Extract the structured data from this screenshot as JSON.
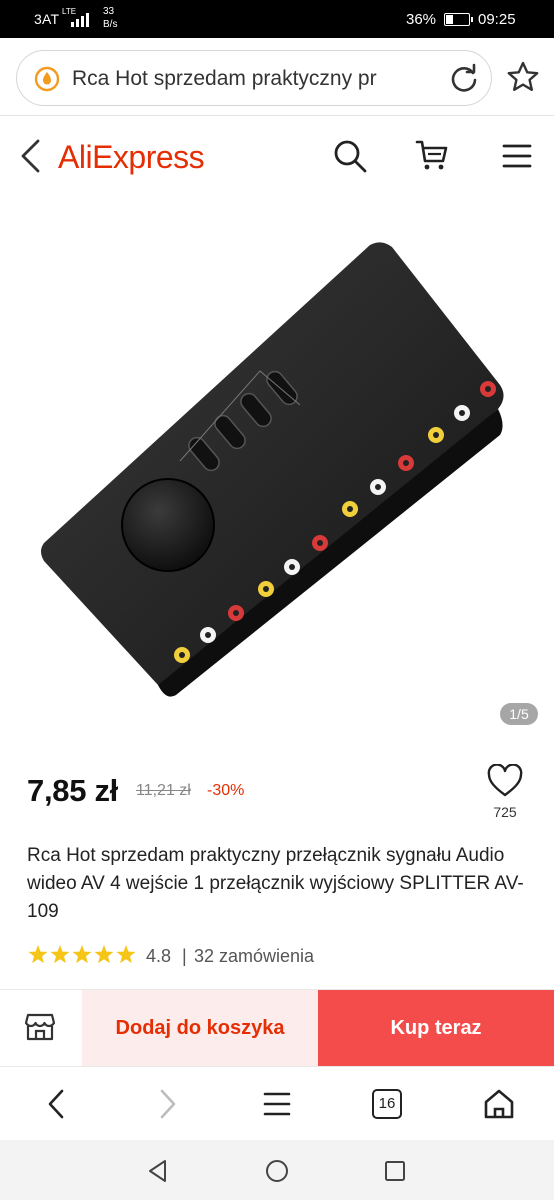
{
  "status_bar": {
    "carrier": "3AT",
    "network": "LTE",
    "speed_value": "33",
    "speed_unit": "B/s",
    "battery": "36%",
    "battery_level": 0.36,
    "time": "09:25"
  },
  "browser": {
    "url_text": "Rca Hot sprzedam praktyczny pr",
    "site_icon": "droplet-icon",
    "reload_icon": "reload-icon",
    "bookmark_icon": "star-icon"
  },
  "site_header": {
    "logo": "AliExpress",
    "icons": [
      "back-chevron-icon",
      "search-icon",
      "cart-icon",
      "hamburger-menu-icon"
    ]
  },
  "gallery": {
    "counter": "1/5"
  },
  "product": {
    "price": "7,85 zł",
    "old_price": "11,21 zł",
    "discount": "-30%",
    "wishlist_count": "725",
    "title": "Rca Hot sprzedam praktyczny przełącznik sygnału Audio wideo AV 4 wejście 1 przełącznik wyjściowy SPLITTER AV-109",
    "rating": "4.8",
    "rating_separator": "|",
    "rating_stars": 4.8,
    "orders": "32 zamówienia"
  },
  "actions": {
    "store_icon": "store-icon",
    "add_to_cart": "Dodaj do koszyka",
    "buy_now": "Kup teraz"
  },
  "browser_bottom": {
    "tab_count": "16",
    "icons": [
      "back-icon",
      "forward-icon",
      "menu-icon",
      "tabs-icon",
      "home-icon"
    ]
  },
  "navbar": {
    "icons": [
      "back-triangle-icon",
      "home-circle-icon",
      "recents-square-icon"
    ]
  },
  "colors": {
    "brand": "#e62e04",
    "buy_now_bg": "#f44b4b",
    "add_cart_bg": "#fdecec",
    "star": "#f5c518"
  }
}
